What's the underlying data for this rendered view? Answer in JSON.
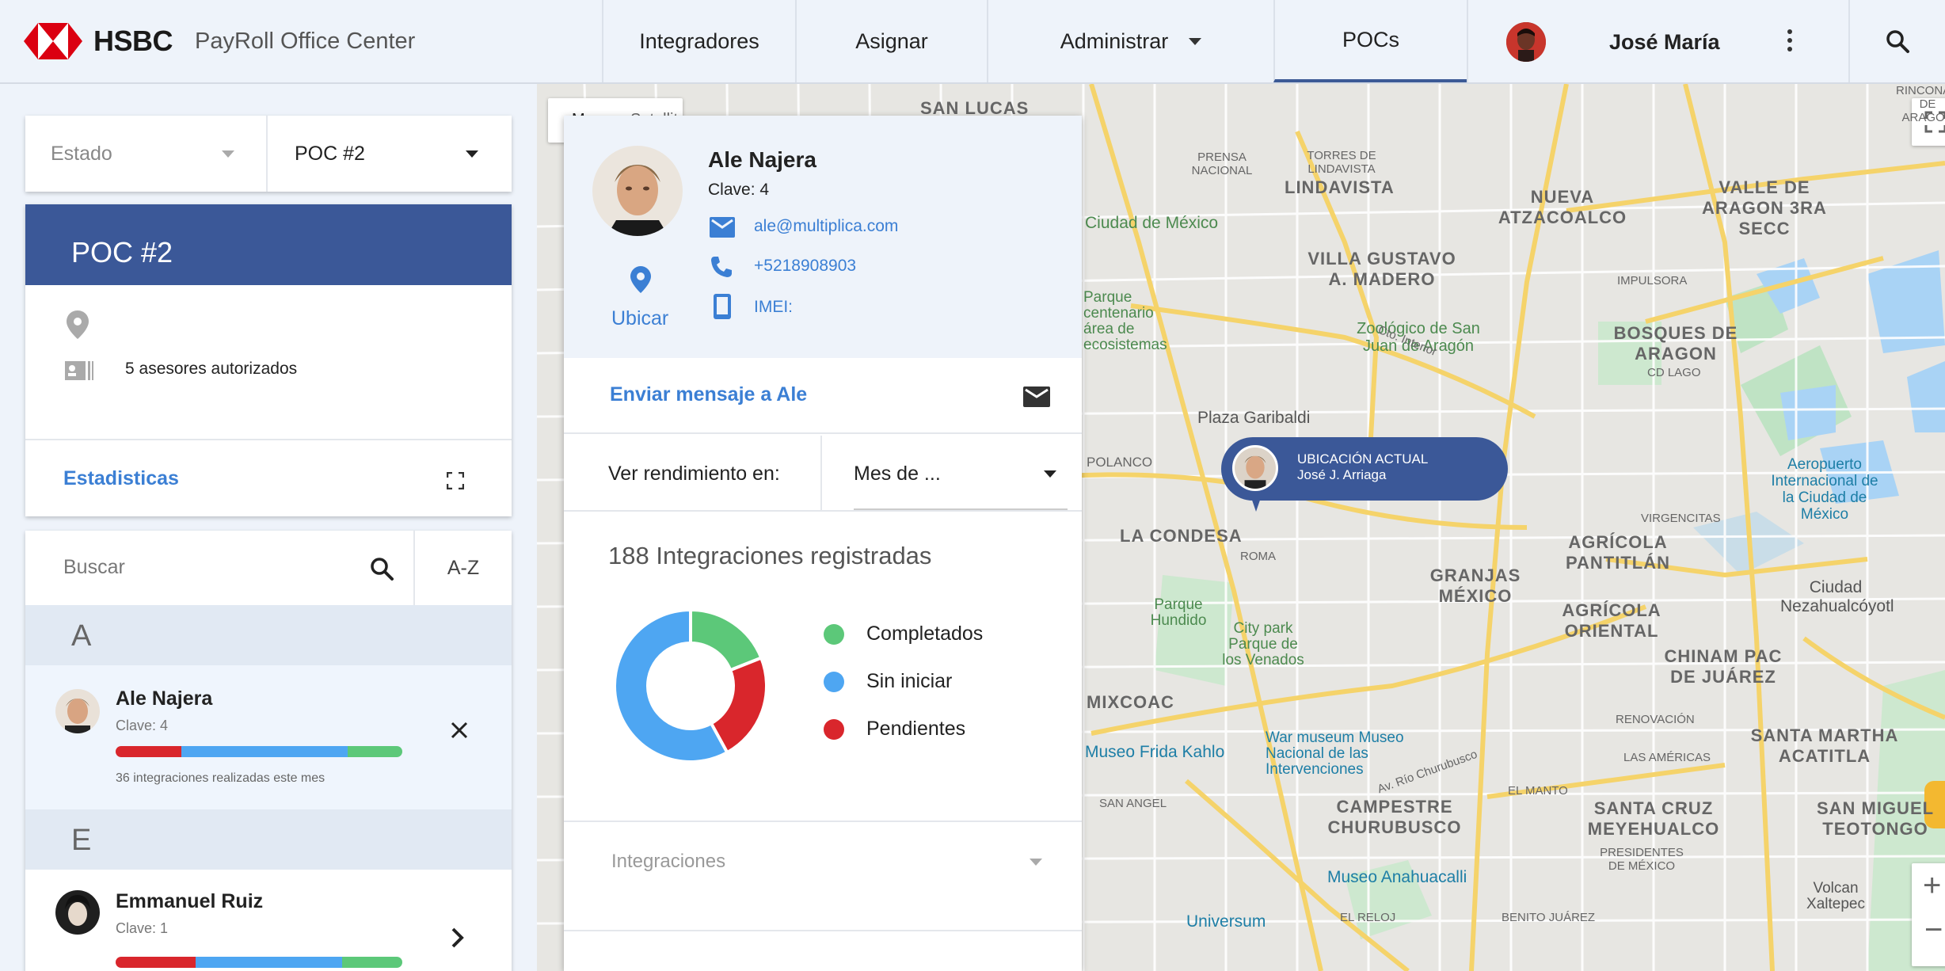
{
  "header": {
    "brand": "HSBC",
    "app_title": "PayRoll Office Center",
    "nav": [
      "Integradores",
      "Asignar",
      "Administrar",
      "POCs"
    ],
    "active_nav": "POCs",
    "user_name": "José María"
  },
  "filters": {
    "estado_placeholder": "Estado",
    "poc_value": "POC #2"
  },
  "poc": {
    "title": "POC #2",
    "asesores": "5 asesores autorizados",
    "stats_label": "Estadisticas"
  },
  "list": {
    "search_placeholder": "Buscar",
    "sort_label": "A-Z",
    "groups": [
      {
        "letter": "A",
        "people": [
          {
            "name": "Ale Najera",
            "clave": "Clave: 4",
            "note": "36 integraciones realizadas este mes",
            "progress": {
              "pendientes": 0.23,
              "sin_iniciar": 0.58,
              "completados": 0.19
            }
          }
        ]
      },
      {
        "letter": "E",
        "people": [
          {
            "name": "Emmanuel Ruiz",
            "clave": "Clave: 1",
            "progress": {
              "pendientes": 0.28,
              "sin_iniciar": 0.51,
              "completados": 0.21
            }
          }
        ]
      }
    ]
  },
  "detail": {
    "name": "Ale Najera",
    "clave": "Clave: 4",
    "email": "ale@multiplica.com",
    "phone": "+5218908903",
    "imei": "IMEI:",
    "locate_label": "Ubicar",
    "send_message": "Enviar mensaje a Ale",
    "performance_label": "Ver rendimiento en:",
    "performance_value": "Mes de ...",
    "count_title": "188 Integraciones registradas",
    "integraciones_label": "Integraciones",
    "legend": [
      {
        "label": "Completados",
        "color": "#5cc879"
      },
      {
        "label": "Sin iniciar",
        "color": "#4ea6f2"
      },
      {
        "label": "Pendientes",
        "color": "#d9262c"
      }
    ]
  },
  "chart_data": {
    "type": "pie",
    "title": "188 Integraciones registradas",
    "categories": [
      "Completados",
      "Pendientes",
      "Sin iniciar"
    ],
    "values": [
      0.19,
      0.23,
      0.58
    ],
    "colors": [
      "#5cc879",
      "#d9262c",
      "#4ea6f2"
    ]
  },
  "map": {
    "location_title": "UBICACIÓN ACTUAL",
    "location_subtitle": "José J. Arriaga",
    "labels": [
      "SAN LUCAS",
      "LINDAVISTA",
      "NUEVA ATZACOALCO",
      "VALLE DE ARAGON 3RA SECC",
      "VILLA GUSTAVO A. MADERO",
      "BOSQUES DE ARAGON",
      "Zoológico de San Juan de Aragón",
      "Ciudad de México",
      "Parque centenario área de ecosistemas",
      "Plaza Garibaldi",
      "Aeropuerto Internacional de la Ciudad de México",
      "POLANCO",
      "LA CONDESA",
      "ROMA",
      "GRANJAS MÉXICO",
      "AGRÍCOLA PANTITLÁN",
      "AGRÍCOLA ORIENTAL",
      "Ciudad Nezahualcóyotl",
      "CHINAM PAC DE JUÁREZ",
      "Parque Hundido",
      "City park Parque de los Venados",
      "MIXCOAC",
      "Museo Frida Kahlo",
      "War museum Museo Nacional de las Intervenciones",
      "SANTA MARTHA ACATITLA",
      "SAN ANGEL",
      "CAMPESTRE CHURUBUSCO",
      "SANTA CRUZ MEYEHUALCO",
      "SAN MIGUEL TEOTONGO",
      "Museo Anahuacalli",
      "Universum",
      "Volcan Xaltepec",
      "Cto. Interior",
      "Av. Río Churubusco",
      "VIRGENCITAS",
      "RENOVACIÓN",
      "LAS AMÉRICAS",
      "EL MANTO",
      "PRESIDENTES DE MÉXICO",
      "BENITO JUÁREZ",
      "EL RELOJ",
      "IMPULSORA",
      "CD LAGO",
      "TORRES DE LINDAVISTA",
      "PRENSA NACIONAL",
      "RINCONADA DE ARAGON",
      "Map",
      "Satellite"
    ]
  }
}
